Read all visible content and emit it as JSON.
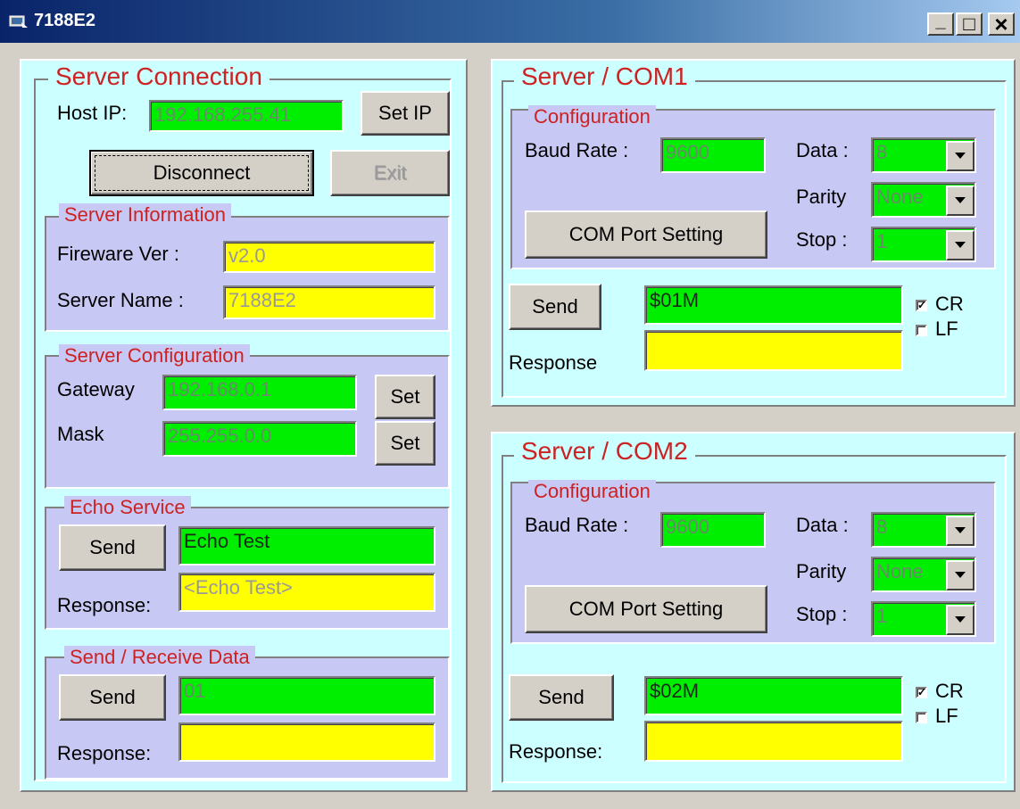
{
  "window": {
    "title": "7188E2",
    "minimize_label": "_",
    "maximize_label": "□",
    "close_label": "×"
  },
  "server_connection": {
    "title": "Server Connection",
    "host_ip_label": "Host IP:",
    "host_ip_value": "192.168.255.41",
    "set_ip_label": "Set IP",
    "disconnect_label": "Disconnect",
    "exit_label": "Exit",
    "server_information": {
      "title": "Server Information",
      "firmware_label": "Fireware Ver :",
      "firmware_value": "v2.0",
      "server_name_label": "Server Name :",
      "server_name_value": "7188E2"
    },
    "server_configuration": {
      "title": "Server Configuration",
      "gateway_label": "Gateway",
      "gateway_value": "192.168.0.1",
      "mask_label": "Mask",
      "mask_value": "255.255.0.0",
      "set_label": "Set"
    },
    "echo_service": {
      "title": "Echo Service",
      "send_label": "Send",
      "input_value": "Echo Test",
      "response_label": "Response:",
      "response_value": "<Echo Test>"
    },
    "send_receive": {
      "title": "Send / Receive Data",
      "send_label": "Send",
      "input_value": "01",
      "response_label": "Response:",
      "response_value": ""
    }
  },
  "com1": {
    "title": "Server / COM1",
    "config_title": "Configuration",
    "baud_label": "Baud Rate :",
    "baud_value": "9600",
    "data_label": "Data :",
    "data_value": "8",
    "parity_label": "Parity",
    "parity_value": "None",
    "stop_label": "Stop :",
    "stop_value": "1",
    "com_port_button": "COM Port Setting",
    "send_label": "Send",
    "command_value": "$01M",
    "cr_label": "CR",
    "cr_checked": true,
    "lf_label": "LF",
    "lf_checked": false,
    "response_label": "Response",
    "response_value": ""
  },
  "com2": {
    "title": "Server / COM2",
    "config_title": "Configuration",
    "baud_label": "Baud Rate :",
    "baud_value": "9600",
    "data_label": "Data :",
    "data_value": "8",
    "parity_label": "Parity",
    "parity_value": "None",
    "stop_label": "Stop :",
    "stop_value": "1",
    "com_port_button": "COM Port Setting",
    "send_label": "Send",
    "command_value": "$02M",
    "cr_label": "CR",
    "cr_checked": true,
    "lf_label": "LF",
    "lf_checked": false,
    "response_label": "Response:",
    "response_value": ""
  },
  "colors": {
    "frame_bg": "#ccffff",
    "subgroup_bg": "#c8c8f4",
    "input_green": "#00ee00",
    "input_yellow": "#ffff00",
    "legend_red": "#cc2222",
    "title_bar": "#0a246a"
  },
  "icons": {
    "app": "app-window-icon",
    "dropdown": "chevron-down-icon"
  }
}
